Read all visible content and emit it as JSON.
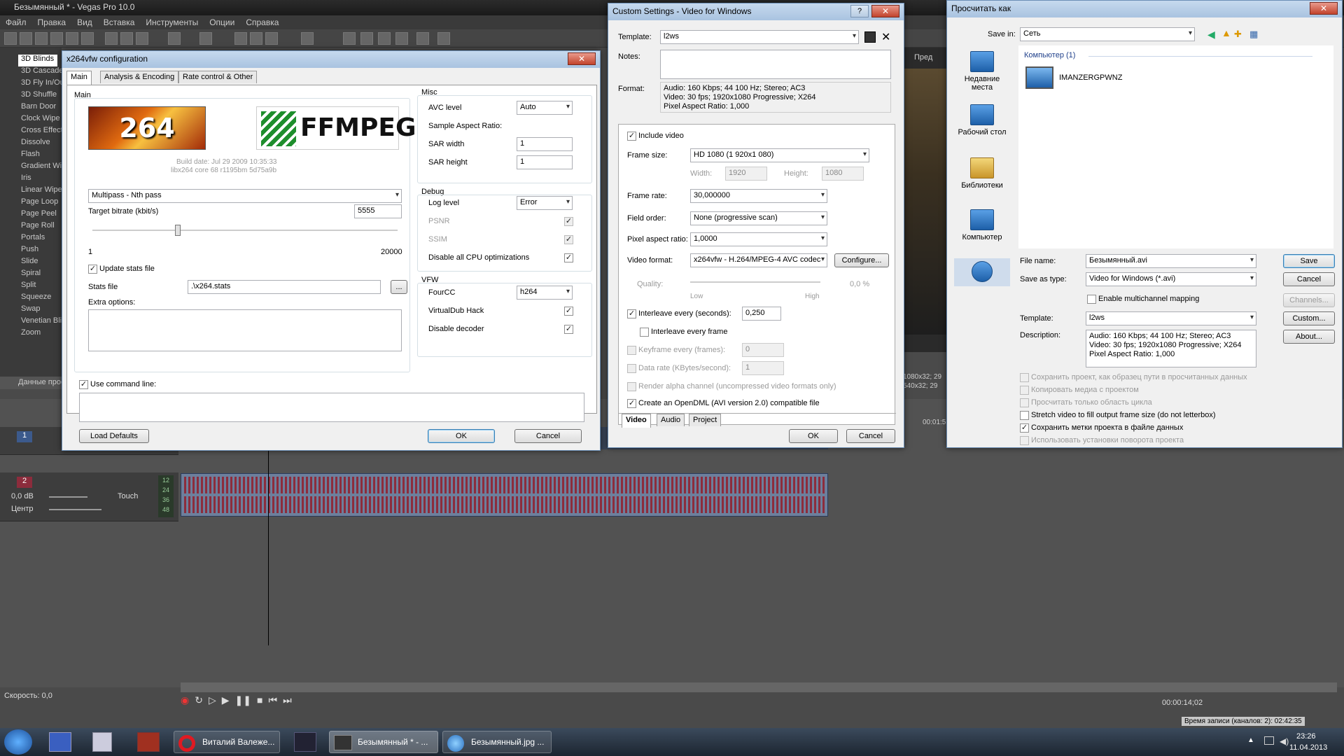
{
  "app": {
    "title": "Безымянный * - Vegas Pro 10.0",
    "menu": [
      "Файл",
      "Правка",
      "Вид",
      "Вставка",
      "Инструменты",
      "Опции",
      "Справка"
    ]
  },
  "left_panel": {
    "items": [
      "3D Blinds",
      "3D Cascade",
      "3D Fly In/Out",
      "3D Shuffle",
      "Barn Door",
      "Clock Wipe",
      "Cross Effect",
      "Dissolve",
      "Flash",
      "Gradient Wipe",
      "Iris",
      "Linear Wipe",
      "Page Loop",
      "Page Peel",
      "Page Roll",
      "Portals",
      "Push",
      "Slide",
      "Spiral",
      "Split",
      "Squeeze",
      "Swap",
      "Venetian Blinds",
      "Zoom"
    ],
    "tab_label": "Данные проекта"
  },
  "preview": {
    "label": "Пред",
    "info1": "1080x32; 29",
    "info2": "540x32; 29"
  },
  "timeline": {
    "track1_num": "1",
    "track2_num": "2",
    "volume": "0,0 dB",
    "touch": "Touch",
    "pan": "Центр",
    "speed": "Скорость: 0,0",
    "ruler_time": "00:01:5",
    "time_code": "00:00:14;02",
    "record_info": "Время записи (каналов: 2): 02:42:35",
    "meter": [
      "12",
      "24",
      "36",
      "48"
    ]
  },
  "x264": {
    "title": "x264vfw configuration",
    "close": "✕",
    "tabs": [
      "Main",
      "Analysis & Encoding",
      "Rate control & Other"
    ],
    "main_label": "Main",
    "logo_left": "264",
    "logo_right": "FFMPEG",
    "build1": "Build date: Jul 29 2009 10:35:33",
    "build2": "libx264 core 68 r1195bm 5d75a9b",
    "mode": "Multipass - Nth pass",
    "target_bitrate_label": "Target bitrate (kbit/s)",
    "target_bitrate": "5555",
    "slider_level": 0.28,
    "slider_min": "1",
    "slider_max": "20000",
    "update_stats": "Update stats file",
    "stats_file_label": "Stats file",
    "stats_file": ".\\x264.stats",
    "browse": "...",
    "extra_label": "Extra options:",
    "misc_label": "Misc",
    "avc_level_label": "AVC level",
    "avc_level": "Auto",
    "sar_label": "Sample Aspect Ratio:",
    "sar_width_label": "SAR width",
    "sar_width": "1",
    "sar_height_label": "SAR height",
    "sar_height": "1",
    "debug_label": "Debug",
    "log_level_label": "Log level",
    "log_level": "Error",
    "psnr": "PSNR",
    "ssim": "SSIM",
    "disable_cpu": "Disable all CPU optimizations",
    "vfw_label": "VFW",
    "fourcc_label": "FourCC",
    "fourcc": "h264",
    "vdub_hack": "VirtualDub Hack",
    "disable_decoder": "Disable decoder",
    "use_cmdline": "Use command line:",
    "load_defaults": "Load Defaults",
    "ok": "OK",
    "cancel": "Cancel"
  },
  "custom": {
    "title": "Custom Settings - Video for Windows",
    "help": "?",
    "close": "✕",
    "template_label": "Template:",
    "template": "l2ws",
    "notes_label": "Notes:",
    "format_label": "Format:",
    "format_lines": [
      "Audio: 160 Kbps; 44 100 Hz; Stereo; AC3",
      "Video: 30 fps; 1920x1080 Progressive; X264",
      "Pixel Aspect Ratio: 1,000"
    ],
    "include_video": "Include video",
    "frame_size_label": "Frame size:",
    "frame_size": "HD 1080 (1 920x1 080)",
    "width_label": "Width:",
    "width": "1920",
    "height_label": "Height:",
    "height": "1080",
    "frame_rate_label": "Frame rate:",
    "frame_rate": "30,000000",
    "field_order_label": "Field order:",
    "field_order": "None (progressive scan)",
    "par_label": "Pixel aspect ratio:",
    "par": "1,0000",
    "video_format_label": "Video format:",
    "video_format": "x264vfw - H.264/MPEG-4 AVC codec",
    "configure": "Configure...",
    "quality_label": "Quality:",
    "quality_low": "Low",
    "quality_high": "High",
    "quality_value": "0,0 %",
    "interleave_label": "Interleave every (seconds):",
    "interleave": "0,250",
    "interleave_frame": "Interleave every frame",
    "keyframe_label": "Keyframe every (frames):",
    "keyframe": "0",
    "datarate_label": "Data rate (KBytes/second):",
    "datarate": "1",
    "alpha": "Render alpha channel (uncompressed video formats only)",
    "opendml": "Create an OpenDML (AVI version 2.0) compatible file",
    "tabs": [
      "Video",
      "Audio",
      "Project"
    ],
    "ok": "OK",
    "cancel": "Cancel"
  },
  "saveas": {
    "title": "Просчитать как",
    "save_in_label": "Save in:",
    "save_in": "Сеть",
    "places": [
      "Недавние места",
      "Рабочий стол",
      "Библиотеки",
      "Компьютер"
    ],
    "group_header": "Компьютер (1)",
    "computer_name": "IMANZERGPWNZ",
    "file_name_label": "File name:",
    "file_name": "Безымянный.avi",
    "save_type_label": "Save as type:",
    "save_type": "Video for Windows (*.avi)",
    "multichannel": "Enable multichannel mapping",
    "template_label": "Template:",
    "template": "l2ws",
    "description_label": "Description:",
    "description_lines": [
      "Audio: 160 Kbps; 44 100 Hz; Stereo; AC3",
      "Video: 30 fps; 1920x1080 Progressive; X264",
      "Pixel Aspect Ratio: 1,000"
    ],
    "save": "Save",
    "cancel": "Cancel",
    "channels": "Channels...",
    "custom": "Custom...",
    "about": "About...",
    "options": [
      "Сохранить проект, как образец пути в просчитанных данных",
      "Копировать медиа с проектом",
      "Просчитать только область цикла",
      "Stretch video to fill output frame size (do not letterbox)",
      "Сохранить метки проекта в файле данных",
      "Использовать установки поворота проекта"
    ]
  },
  "taskbar": {
    "tasks": [
      "Виталий Валеже...",
      "Безымянный * - ...",
      "Безымянный.jpg ..."
    ],
    "time": "23:26",
    "date": "11.04.2013"
  }
}
